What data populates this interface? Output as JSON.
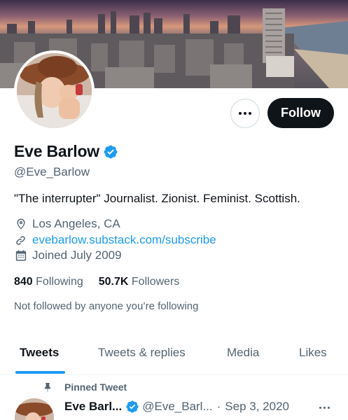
{
  "profile": {
    "display_name": "Eve Barlow",
    "handle": "@Eve_Barlow",
    "bio": "\"The interrupter\" Journalist. Zionist. Feminist. Scottish.",
    "location": "Los Angeles, CA",
    "website": "evebarlow.substack.com/subscribe",
    "joined": "Joined July 2009",
    "following_count": "840",
    "following_label": "Following",
    "followers_count": "50.7K",
    "followers_label": "Followers",
    "not_followed_text": "Not followed by anyone you’re following"
  },
  "actions": {
    "follow_label": "Follow",
    "more_icon": "more-horizontal-icon"
  },
  "tabs": [
    {
      "label": "Tweets",
      "active": true
    },
    {
      "label": "Tweets & replies",
      "active": false
    },
    {
      "label": "Media",
      "active": false
    },
    {
      "label": "Likes",
      "active": false
    }
  ],
  "pinned_tweet": {
    "pinned_label": "Pinned Tweet",
    "name": "Eve Barl...",
    "handle": "@Eve_Barl...",
    "separator": "·",
    "date": "Sep 3, 2020"
  },
  "colors": {
    "accent": "#1d9bf0",
    "text_primary": "#0f1419",
    "text_secondary": "#536471",
    "follow_button_bg": "#0f1419"
  },
  "icons": {
    "verified": "verified-badge-icon",
    "location": "location-pin-icon",
    "link": "link-icon",
    "calendar": "calendar-icon",
    "pin": "pin-icon"
  }
}
